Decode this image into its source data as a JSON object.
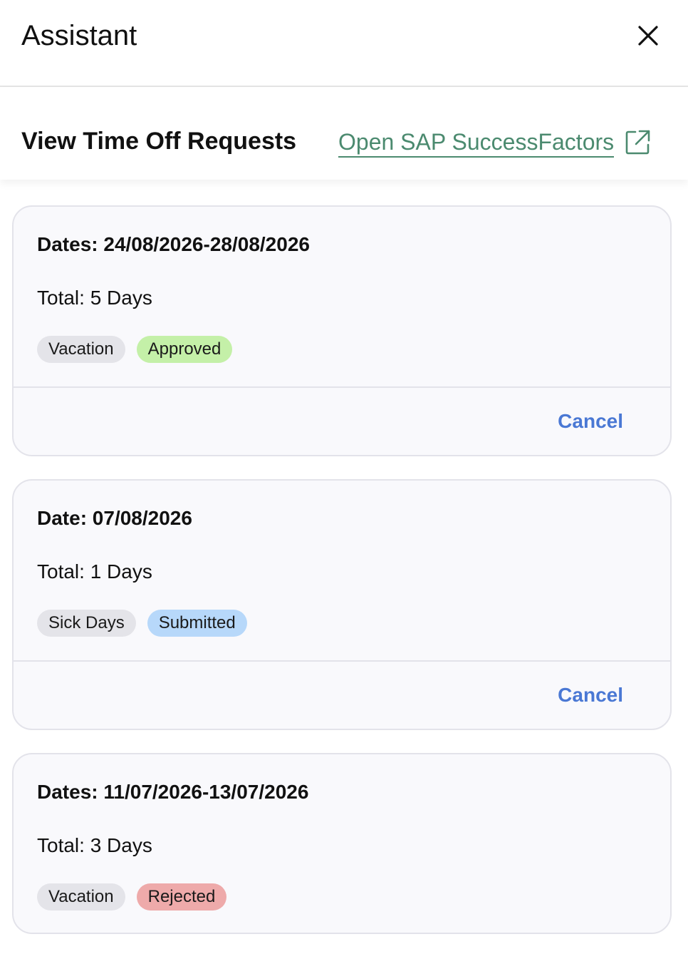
{
  "window": {
    "title": "Assistant",
    "close_icon": "close-icon"
  },
  "header": {
    "title": "View Time Off Requests",
    "link_label": "Open SAP SuccessFactors",
    "link_icon": "external-link-icon",
    "link_color": "#4b8a6f"
  },
  "colors": {
    "type_tag_bg": "#e4e4e9",
    "approved_bg": "#c4f0a8",
    "submitted_bg": "#b7d8fa",
    "rejected_bg": "#eeaaaa",
    "cancel_color": "#4a78d4"
  },
  "requests": [
    {
      "dates": "Dates: 24/08/2026-28/08/2026",
      "total": "Total: 5 Days",
      "type": "Vacation",
      "status": "Approved",
      "status_color": "#c4f0a8",
      "action_label": "Cancel"
    },
    {
      "dates": "Date: 07/08/2026",
      "total": "Total: 1 Days",
      "type": "Sick Days",
      "status": "Submitted",
      "status_color": "#b7d8fa",
      "action_label": "Cancel"
    },
    {
      "dates": "Dates: 11/07/2026-13/07/2026",
      "total": "Total: 3 Days",
      "type": "Vacation",
      "status": "Rejected",
      "status_color": "#eeaaaa"
    }
  ]
}
